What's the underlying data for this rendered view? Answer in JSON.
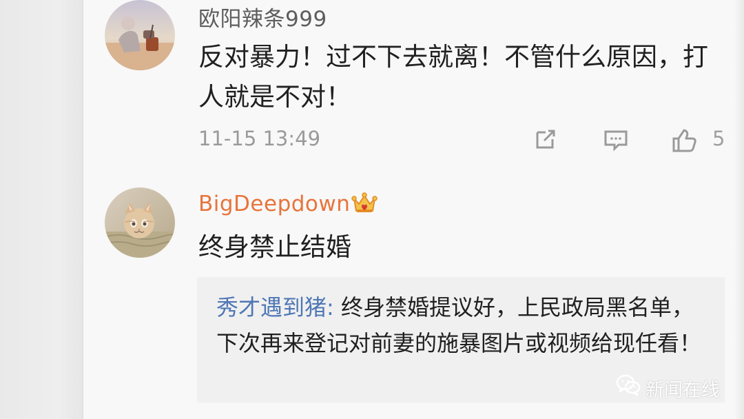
{
  "comments": [
    {
      "username": "欧阳辣条999",
      "text": "反对暴力！过不下去就离！不管什么原因，打人就是不对！",
      "timestamp": "11-15 13:49",
      "likes": "5",
      "avatar_icon": "traveler-avatar-icon"
    },
    {
      "username": "BigDeepdown",
      "text": "终身禁止结婚",
      "badge_icon": "crown-icon",
      "avatar_icon": "cat-avatar-icon",
      "reply": {
        "name": "秀才遇到猪:",
        "text": " 终身禁婚提议好，上民政局黑名单，下次再来登记对前妻的施暴图片或视频给现任看！"
      }
    }
  ],
  "watermark": {
    "label": "新闻在线",
    "icon": "wechat-icon"
  },
  "colors": {
    "username_primary": "#5d5d5d",
    "username_vip": "#e8743b",
    "reply_name": "#4f77b5"
  }
}
